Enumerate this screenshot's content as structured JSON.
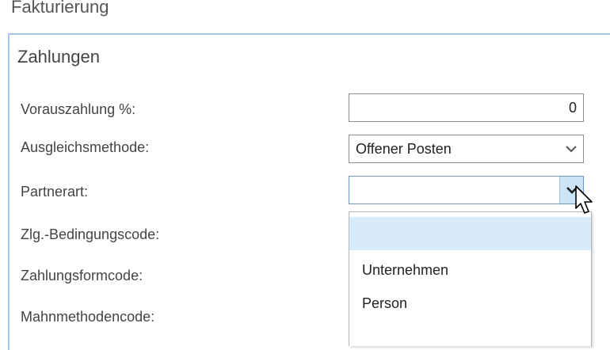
{
  "header": {
    "section_title": "Fakturierung"
  },
  "panel": {
    "title": "Zahlungen"
  },
  "fields": {
    "prepayment": {
      "label": "Vorauszahlung %:",
      "value": "0"
    },
    "application_method": {
      "label": "Ausgleichsmethode:",
      "value": "Offener Posten"
    },
    "partner_type": {
      "label": "Partnerart:",
      "value": ""
    },
    "payment_terms_code": {
      "label": "Zlg.-Bedingungscode:"
    },
    "payment_method_code": {
      "label": "Zahlungsformcode:"
    },
    "reminder_terms_code": {
      "label": "Mahnmethodencode:"
    }
  },
  "dropdown": {
    "options": [
      "",
      "Unternehmen",
      "Person"
    ]
  },
  "icons": {
    "dropdown_arrow": "chevron-down-icon",
    "pointer": "mouse-cursor-icon"
  },
  "colors": {
    "panel_border": "#a9c6e8",
    "highlight": "#d7ebfb",
    "active_chevron": "#cbe4f6"
  }
}
